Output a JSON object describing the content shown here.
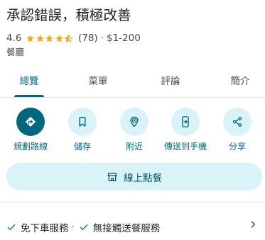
{
  "place": {
    "name": "承認錯誤，積極改善",
    "rating": "4.6",
    "stars_value": 4.6,
    "stars_max": 5,
    "review_count": "(78)",
    "separator": "·",
    "price_range": "$1-200",
    "category": "餐廳"
  },
  "tabs": [
    {
      "label": "總覽",
      "active": true
    },
    {
      "label": "菜單",
      "active": false
    },
    {
      "label": "評論",
      "active": false
    },
    {
      "label": "簡介",
      "active": false
    }
  ],
  "actions": [
    {
      "label": "規劃路線",
      "icon": "directions-icon"
    },
    {
      "label": "儲存",
      "icon": "bookmark-icon"
    },
    {
      "label": "附近",
      "icon": "nearby-icon"
    },
    {
      "label": "傳送到手機",
      "icon": "send-to-phone-icon"
    },
    {
      "label": "分享",
      "icon": "share-icon"
    }
  ],
  "order_button": {
    "label": "線上點餐",
    "icon": "store-icon"
  },
  "services": {
    "items": [
      "免下車服務",
      "無接觸送餐服務"
    ],
    "separator": "·"
  },
  "colors": {
    "accent": "#00677d",
    "accent_light": "#d9f3f9",
    "star": "#f3a91a",
    "check": "#188038"
  }
}
